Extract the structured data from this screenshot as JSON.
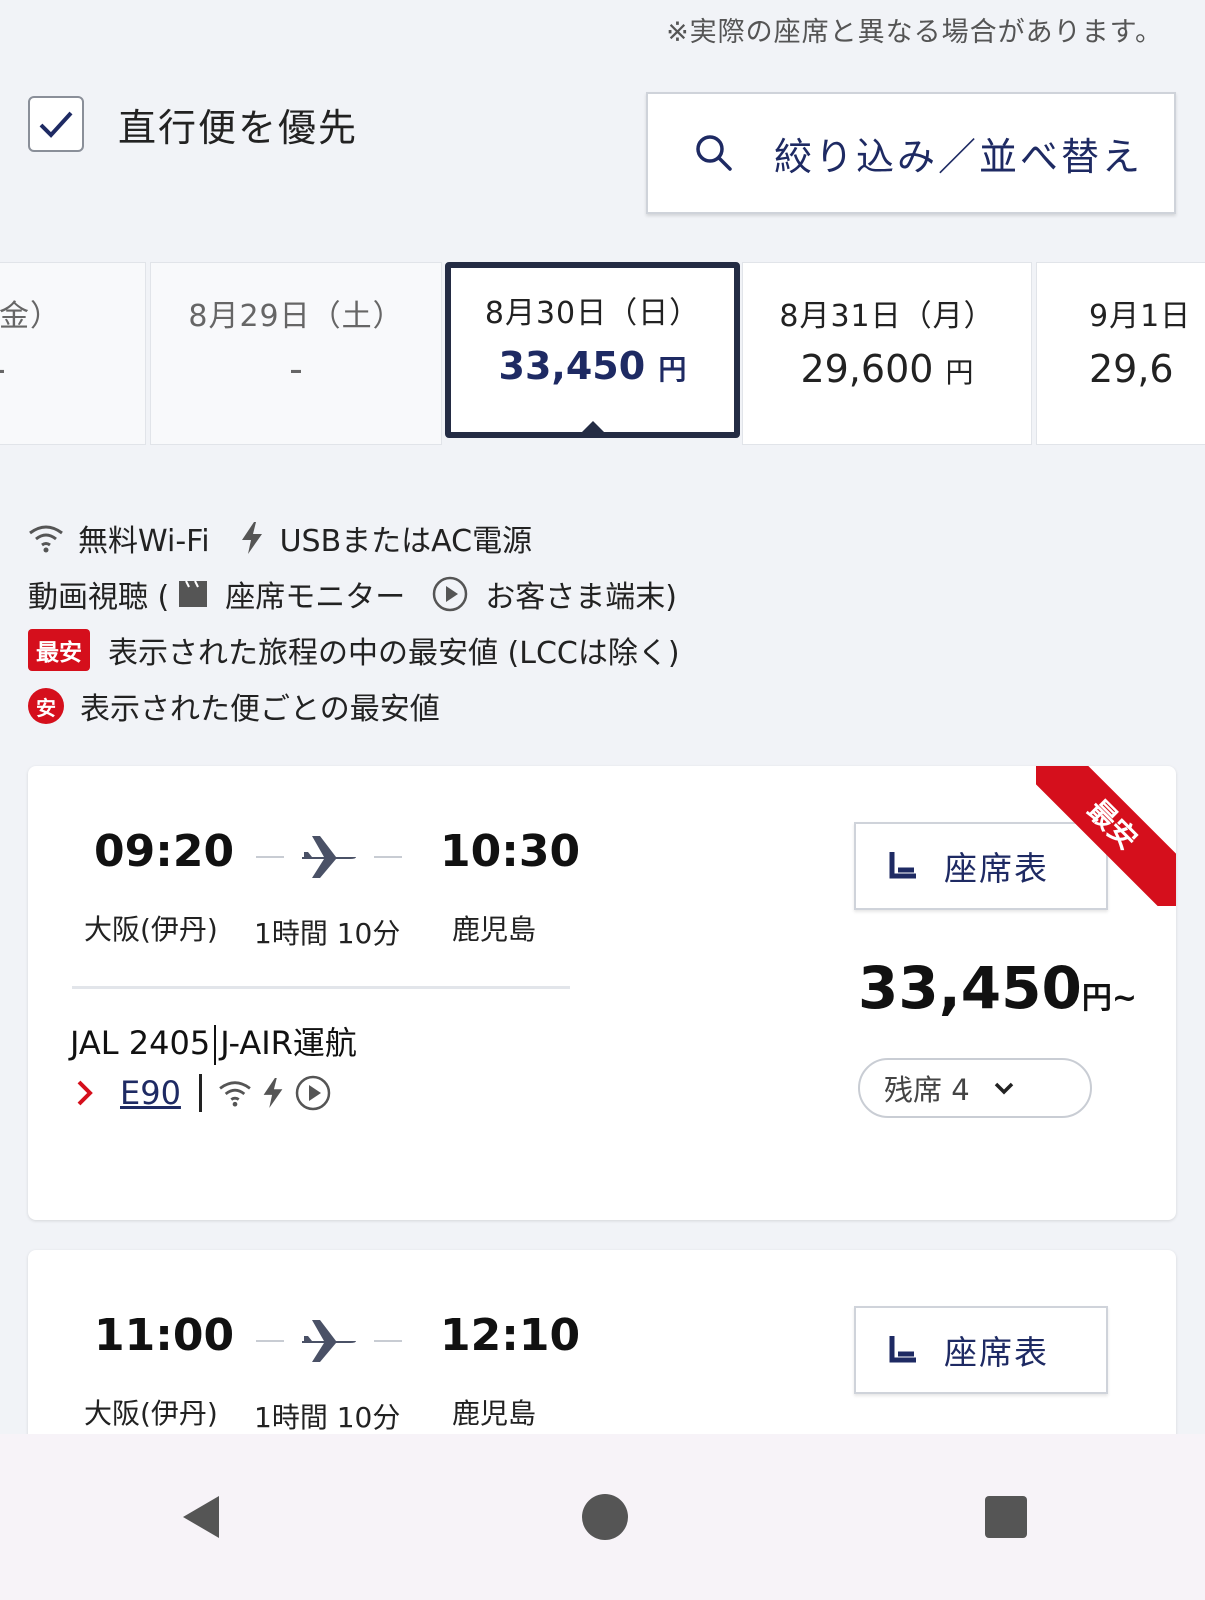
{
  "notice": "※実際の座席と異なる場合があります。",
  "direct": {
    "label": "直行便を優先",
    "checked": true
  },
  "filter": {
    "label": "絞り込み／並べ替え",
    "icon": "search-icon"
  },
  "dates": [
    {
      "date": "日（金）",
      "price": "-"
    },
    {
      "date": "8月29日（土）",
      "price": "-"
    },
    {
      "date": "8月30日（日）",
      "price": "33,450",
      "unit": "円",
      "selected": true
    },
    {
      "date": "8月31日（月）",
      "price": "29,600",
      "unit": "円"
    },
    {
      "date": "9月1日",
      "price": "29,6"
    }
  ],
  "legend": {
    "wifi": "無料Wi-Fi",
    "power": "USBまたはAC電源",
    "video_prefix": "動画視聴 (",
    "seat_monitor": "座席モニター",
    "own_device": "お客さま端末)",
    "lowest_badge": "最安",
    "lowest_text": "表示された旅程の中の最安値 (LCCは除く)",
    "flight_low_badge": "安",
    "flight_low_text": "表示された便ごとの最安値"
  },
  "flights": [
    {
      "depart_time": "09:20",
      "arrive_time": "10:30",
      "depart_airport": "大阪(伊丹)",
      "arrive_airport": "鹿児島",
      "duration": "1時間 10分",
      "flight_no": "JAL 2405",
      "operator": "J-AIR運航",
      "aircraft": "E90",
      "seatmap_label": "座席表",
      "price": "33,450",
      "price_unit": "円~",
      "seats_left": "残席 4",
      "ribbon": "最安"
    },
    {
      "depart_time": "11:00",
      "arrive_time": "12:10",
      "depart_airport": "大阪(伊丹)",
      "arrive_airport": "鹿児島",
      "duration": "1時間 10分",
      "seatmap_label": "座席表"
    }
  ],
  "colors": {
    "brand_navy": "#1e2a63",
    "accent_red": "#d50f1c",
    "active_border": "#242c44"
  }
}
